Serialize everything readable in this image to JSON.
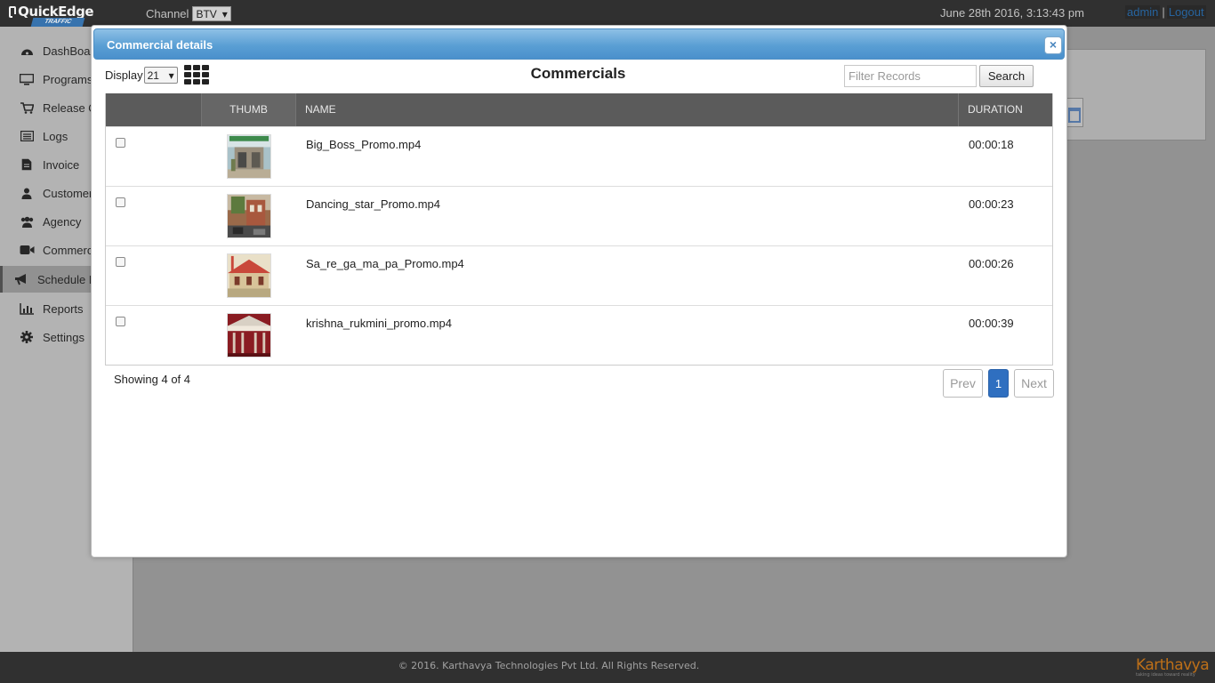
{
  "app": {
    "logo_text": "QuickEdge",
    "logo_sub": "TRAFFIC",
    "channel_label": "Channel",
    "channel_value": "BTV",
    "datetime": "June 28th 2016, 3:13:43 pm",
    "user_link": "admin",
    "separator": "|",
    "logout_link": "Logout"
  },
  "sidebar": {
    "items": [
      {
        "label": "DashBoar",
        "icon": "dashboard-icon"
      },
      {
        "label": "Programs",
        "icon": "monitor-icon"
      },
      {
        "label": "Release O",
        "icon": "cart-icon"
      },
      {
        "label": "Logs",
        "icon": "list-icon"
      },
      {
        "label": "Invoice",
        "icon": "document-icon"
      },
      {
        "label": "Customers",
        "icon": "user-icon"
      },
      {
        "label": "Agency",
        "icon": "users-icon"
      },
      {
        "label": "Commerc",
        "icon": "video-camera-icon"
      },
      {
        "label": "Schedule P",
        "icon": "megaphone-icon"
      },
      {
        "label": "Reports",
        "icon": "bar-chart-icon"
      },
      {
        "label": "Settings",
        "icon": "gear-icon"
      }
    ]
  },
  "footer": {
    "copyright": "© 2016. Karthavya Technologies Pvt Ltd. All Rights Reserved.",
    "brand": "Karthavya",
    "brand_tagline": "taking ideas toward reality"
  },
  "modal": {
    "title": "Commercial details",
    "close_label": "×",
    "display_label": "Display",
    "display_value": "21",
    "list_title": "Commercials",
    "filter_placeholder": "Filter Records",
    "search_label": "Search",
    "columns": {
      "thumb": "THUMB",
      "name": "NAME",
      "duration": "DURATION"
    },
    "rows": [
      {
        "name": "Big_Boss_Promo.mp4",
        "duration": "00:00:18",
        "checked": false
      },
      {
        "name": "Dancing_star_Promo.mp4",
        "duration": "00:00:23",
        "checked": false
      },
      {
        "name": "Sa_re_ga_ma_pa_Promo.mp4",
        "duration": "00:00:26",
        "checked": false
      },
      {
        "name": "krishna_rukmini_promo.mp4",
        "duration": "00:00:39",
        "checked": false
      }
    ],
    "showing": "Showing 4 of 4",
    "pager": {
      "prev": "Prev",
      "page": "1",
      "next": "Next"
    }
  },
  "colors": {
    "header_blue": "#5a9fd4",
    "table_header": "#5b5b5b",
    "active_page": "#2f6fc0",
    "brand_orange": "#c9761a"
  }
}
